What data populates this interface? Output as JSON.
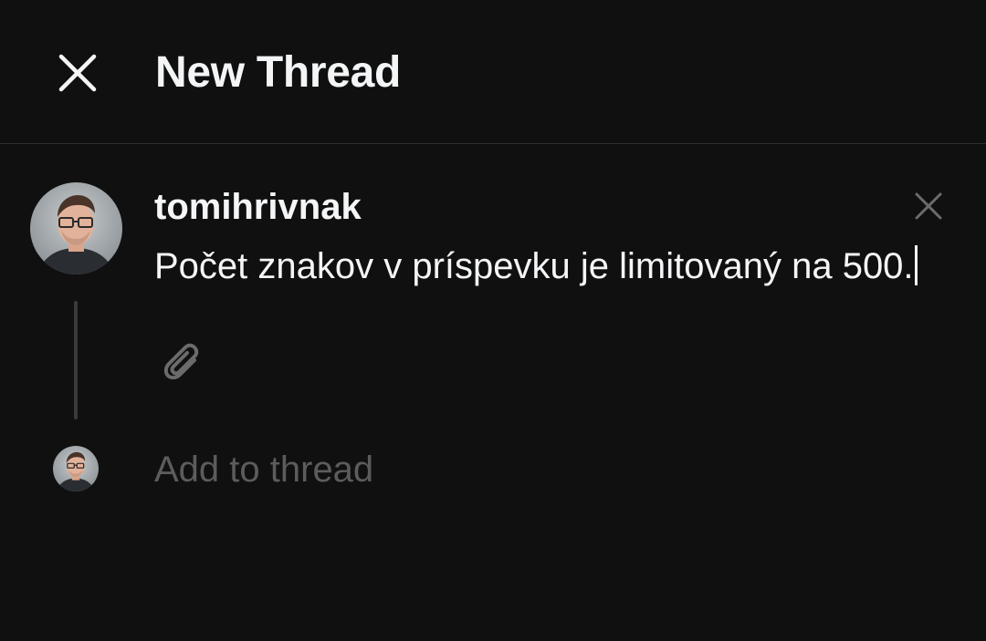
{
  "header": {
    "title": "New Thread",
    "close_icon": "close-icon"
  },
  "composer": {
    "username": "tomihrivnak",
    "text": "Počet znakov v príspevku je limitovaný na 500.",
    "remove_icon": "close-icon",
    "attach_icon": "paperclip-icon",
    "avatar": "avatar"
  },
  "next_post": {
    "placeholder": "Add to thread",
    "avatar": "avatar"
  },
  "colors": {
    "background": "#101010",
    "text_primary": "#f3f5f7",
    "text_muted": "#5c5c5c",
    "divider": "#2e2e2e",
    "thread_line": "#3a3a3a"
  }
}
